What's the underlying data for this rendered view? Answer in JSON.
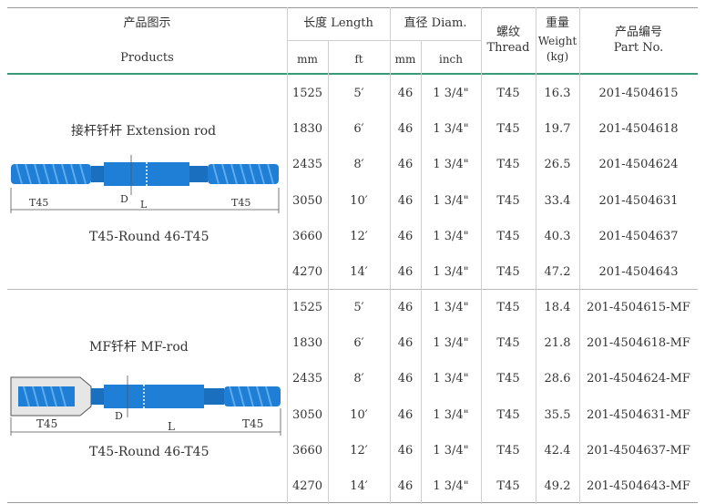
{
  "header": {
    "products_cn": "产品图示",
    "products_en": "Products",
    "length_label": "长度 Length",
    "diam_label": "直径 Diam.",
    "thread_cn": "螺纹",
    "thread_en": "Thread",
    "weight_cn": "重量",
    "weight_en": "Weight",
    "weight_unit": "(kg)",
    "part_cn": "产品编号",
    "part_en": "Part No.",
    "unit_mm": "mm",
    "unit_ft": "ft",
    "unit_mm2": "mm",
    "unit_inch": "inch"
  },
  "groups": [
    {
      "title": "接杆钎杆  Extension rod",
      "caption": "T45-Round 46-T45",
      "diagram": {
        "left_label": "T45",
        "right_label": "T45",
        "d_label": "D",
        "l_label": "L"
      },
      "rows": [
        {
          "mm": "1525",
          "ft": "5′",
          "dmm": "46",
          "inch": "1 3/4\"",
          "thread": "T45",
          "weight": "16.3",
          "part": "201-4504615"
        },
        {
          "mm": "1830",
          "ft": "6′",
          "dmm": "46",
          "inch": "1 3/4\"",
          "thread": "T45",
          "weight": "19.7",
          "part": "201-4504618"
        },
        {
          "mm": "2435",
          "ft": "8′",
          "dmm": "46",
          "inch": "1 3/4\"",
          "thread": "T45",
          "weight": "26.5",
          "part": "201-4504624"
        },
        {
          "mm": "3050",
          "ft": "10′",
          "dmm": "46",
          "inch": "1 3/4\"",
          "thread": "T45",
          "weight": "33.4",
          "part": "201-4504631"
        },
        {
          "mm": "3660",
          "ft": "12′",
          "dmm": "46",
          "inch": "1 3/4\"",
          "thread": "T45",
          "weight": "40.3",
          "part": "201-4504637"
        },
        {
          "mm": "4270",
          "ft": "14′",
          "dmm": "46",
          "inch": "1 3/4\"",
          "thread": "T45",
          "weight": "47.2",
          "part": "201-4504643"
        }
      ]
    },
    {
      "title": "MF钎杆   MF-rod",
      "caption": "T45-Round 46-T45",
      "diagram": {
        "left_label": "T45",
        "right_label": "T45",
        "d_label": "D",
        "l_label": "L"
      },
      "rows": [
        {
          "mm": "1525",
          "ft": "5′",
          "dmm": "46",
          "inch": "1 3/4\"",
          "thread": "T45",
          "weight": "18.4",
          "part": "201-4504615-MF"
        },
        {
          "mm": "1830",
          "ft": "6′",
          "dmm": "46",
          "inch": "1 3/4\"",
          "thread": "T45",
          "weight": "21.8",
          "part": "201-4504618-MF"
        },
        {
          "mm": "2435",
          "ft": "8′",
          "dmm": "46",
          "inch": "1 3/4\"",
          "thread": "T45",
          "weight": "28.6",
          "part": "201-4504624-MF"
        },
        {
          "mm": "3050",
          "ft": "10′",
          "dmm": "46",
          "inch": "1 3/4\"",
          "thread": "T45",
          "weight": "35.5",
          "part": "201-4504631-MF"
        },
        {
          "mm": "3660",
          "ft": "12′",
          "dmm": "46",
          "inch": "1 3/4\"",
          "thread": "T45",
          "weight": "42.4",
          "part": "201-4504637-MF"
        },
        {
          "mm": "4270",
          "ft": "14′",
          "dmm": "46",
          "inch": "1 3/4\"",
          "thread": "T45",
          "weight": "49.2",
          "part": "201-4504643-MF"
        }
      ]
    }
  ],
  "colors": {
    "accent_line": "#3a9a78",
    "rod_blue": "#1f7fd6",
    "grid": "#cfcfcf",
    "text": "#333333"
  }
}
